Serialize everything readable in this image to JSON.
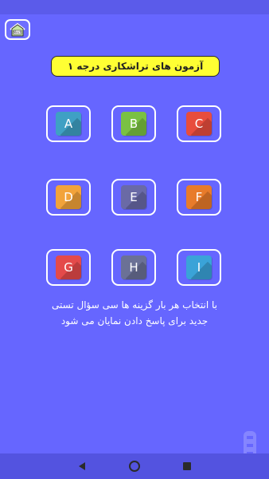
{
  "header": {
    "home_icon": "home-icon",
    "title": "آزمون های تراشکاری درجه ۱"
  },
  "tiles": [
    {
      "label": "A",
      "color": "#3fa0c4"
    },
    {
      "label": "B",
      "color": "#7ac143"
    },
    {
      "label": "C",
      "color": "#e84d3d"
    },
    {
      "label": "D",
      "color": "#f2a33a"
    },
    {
      "label": "E",
      "color": "#6a6aa6"
    },
    {
      "label": "F",
      "color": "#e87b2a"
    },
    {
      "label": "G",
      "color": "#e44a4a"
    },
    {
      "label": "H",
      "color": "#6b7196"
    },
    {
      "label": "I",
      "color": "#3aa3d8"
    }
  ],
  "description": {
    "line1": "با انتخاب هر بار گزینه ها سی سؤال تستی",
    "line2": "جدید برای پاسخ دادن نمایان می شود"
  },
  "colors": {
    "background": "#6666ff",
    "title_bg": "#ffff33",
    "nav_bar": "#5353e0"
  },
  "nav": {
    "back_icon": "back-triangle-icon",
    "home_icon": "home-circle-icon",
    "recents_icon": "recents-square-icon"
  }
}
